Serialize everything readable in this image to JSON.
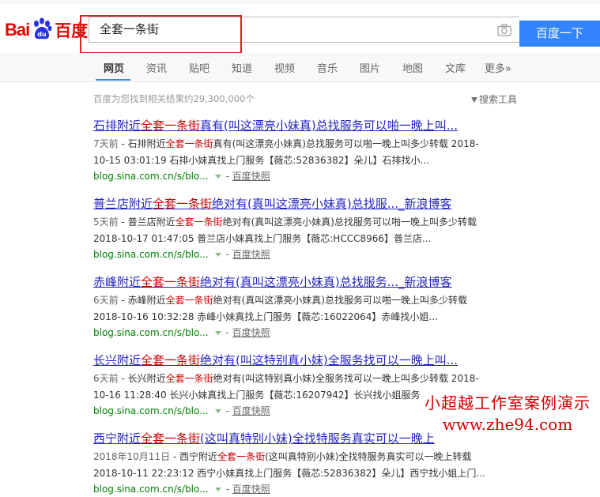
{
  "logo": {
    "left": "Bai",
    "right": "百度",
    "alt": "Baidu"
  },
  "search": {
    "query": "全套一条街",
    "button": "百度一下"
  },
  "tabs": [
    "网页",
    "资讯",
    "贴吧",
    "知道",
    "视频",
    "音乐",
    "图片",
    "地图",
    "文库",
    "更多»"
  ],
  "stats": "百度为您找到相关结果约29,300,000个",
  "tools": "搜索工具",
  "results": [
    {
      "title_pre": "石排附近",
      "title_hl": "全套一条街",
      "title_post": "真有(叫这漂亮小妹真)总找服务可以啪一晚上叫...",
      "time": "7天前",
      "abs_pre": " - 石排附近",
      "abs_hl": "全套一条街",
      "abs_post": "真有(叫这漂亮小妹真)总找服务可以啪一晚上叫多少转载 2018-",
      "line2": "10-15 03:01:19 石排小妹真找上门服务【薇芯:52836382】朵儿】石排找小...",
      "url": "blog.sina.com.cn/s/blo...",
      "sep": "-",
      "snapshot": "百度快照"
    },
    {
      "title_pre": "普兰店附近",
      "title_hl": "全套一条街",
      "title_post": "绝对有(真叫这漂亮小妹真)总找服..._新浪博客",
      "time": "5天前",
      "abs_pre": " - 普兰店附近",
      "abs_hl": "全套一条街",
      "abs_post": "绝对有(真叫这漂亮小妹真)总找服务可以啪一晚上叫多少转载",
      "line2": "2018-10-17 01:47:05 普兰店小妹真找上门服务【薇芯:HCCC8966】普兰店...",
      "url": "blog.sina.com.cn/s/blo...",
      "sep": "-",
      "snapshot": "百度快照"
    },
    {
      "title_pre": "赤峰附近",
      "title_hl": "全套一条街",
      "title_post": "绝对有(真叫这漂亮小妹真)总找服务..._新浪博客",
      "time": "6天前",
      "abs_pre": " - 赤峰附近",
      "abs_hl": "全套一条街",
      "abs_post": "绝对有(真叫这漂亮小妹真)总找服务可以啪一晚上叫多少转载",
      "line2": "2018-10-16 10:32:28 赤峰小妹真找上门服务【薇芯:16022064】赤峰找小姐...",
      "url": "blog.sina.com.cn/s/blo...",
      "sep": "-",
      "snapshot": "百度快照"
    },
    {
      "title_pre": "长兴附近",
      "title_hl": "全套一条街",
      "title_post": "绝对有(叫这特别真小妹)全服务找可以一晚上叫...",
      "time": "6天前",
      "abs_pre": " - 长兴附近",
      "abs_hl": "全套一条街",
      "abs_post": "绝对有(叫这特别真小妹)全服务找可以一晚上叫多少转载 2018-",
      "line2": "10-16 11:28:40 长兴小妹真找上门服务【薇芯:16207942】长兴找小姐服务",
      "url": "blog.sina.com.cn/s/blo...",
      "sep": "-",
      "snapshot": "百度快照"
    },
    {
      "title_pre": "西宁附近",
      "title_hl": "全套一条街",
      "title_post": "(这叫真特别小妹)全找特服务真实可以一晚上",
      "time": "2018年10月11日",
      "abs_pre": " - 西宁附近",
      "abs_hl": "全套一条街",
      "abs_post": "(这叫真特别小妹)全找特服务真实可以一晚上转载",
      "line2": "2018-10-11 22:23:12 西宁小妹真找上门服务【薇芯:52836382】朵儿】西宁找小姐上门...",
      "url": "blog.sina.com.cn/s/blo...",
      "sep": "-",
      "snapshot": "百度快照"
    }
  ],
  "watermark": {
    "line1": "小超越工作室案例演示",
    "line2": "www.zhe94.com"
  }
}
